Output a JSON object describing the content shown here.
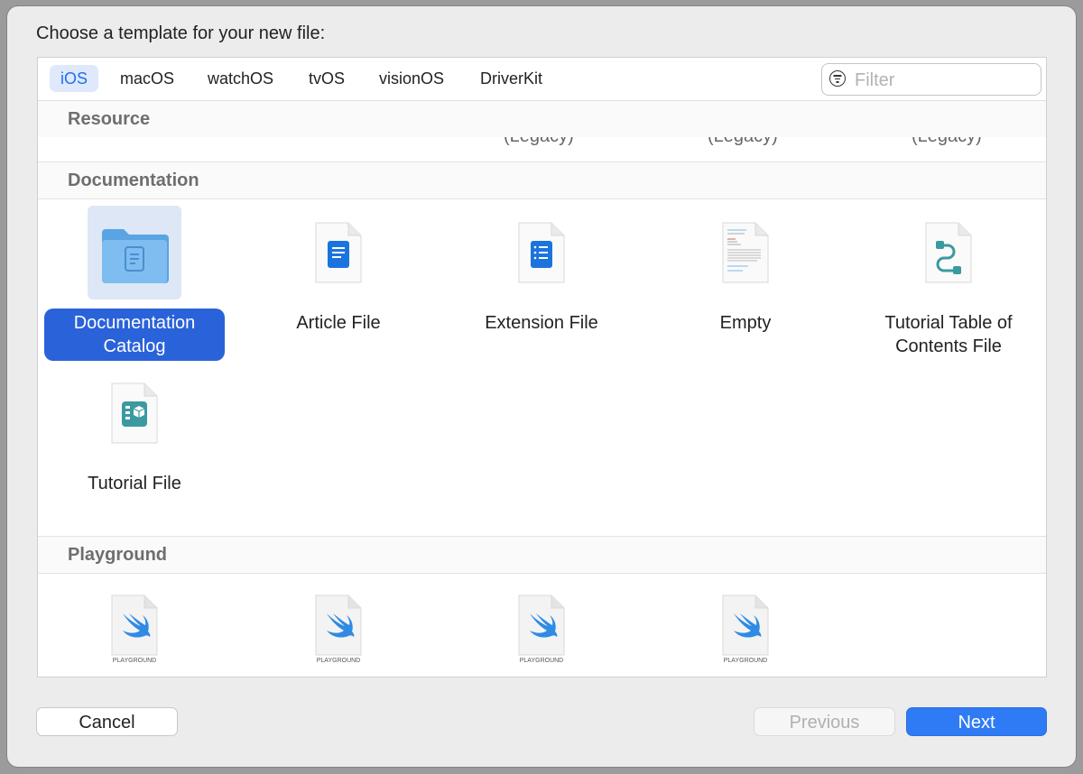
{
  "dialog": {
    "title": "Choose a template for your new file:"
  },
  "platform_tabs": [
    {
      "label": "iOS",
      "active": true
    },
    {
      "label": "macOS",
      "active": false
    },
    {
      "label": "watchOS",
      "active": false
    },
    {
      "label": "tvOS",
      "active": false
    },
    {
      "label": "visionOS",
      "active": false
    },
    {
      "label": "DriverKit",
      "active": false
    }
  ],
  "filter": {
    "placeholder": "Filter",
    "value": "",
    "icon": "filter-circle-icon"
  },
  "sections": {
    "resource": {
      "header": "Resource",
      "clipped_items": [
        "(Legacy)",
        "(Legacy)",
        "(Legacy)"
      ]
    },
    "documentation": {
      "header": "Documentation",
      "items": [
        {
          "label": "Documentation Catalog",
          "icon": "folder-doc-icon",
          "selected": true
        },
        {
          "label": "Article File",
          "icon": "article-file-icon",
          "selected": false
        },
        {
          "label": "Extension File",
          "icon": "extension-file-icon",
          "selected": false
        },
        {
          "label": "Empty",
          "icon": "empty-file-icon",
          "selected": false
        },
        {
          "label": "Tutorial Table of Contents File",
          "icon": "tutorial-toc-icon",
          "selected": false
        },
        {
          "label": "Tutorial File",
          "icon": "tutorial-file-icon",
          "selected": false
        }
      ]
    },
    "playground": {
      "header": "Playground",
      "items": [
        {
          "badge": "PLAYGROUND",
          "icon": "swift-playground-icon"
        },
        {
          "badge": "PLAYGROUND",
          "icon": "swift-playground-icon"
        },
        {
          "badge": "PLAYGROUND",
          "icon": "swift-playground-icon"
        },
        {
          "badge": "PLAYGROUND",
          "icon": "swift-playground-icon"
        }
      ]
    }
  },
  "buttons": {
    "cancel": "Cancel",
    "previous": "Previous",
    "previous_enabled": false,
    "next": "Next"
  },
  "colors": {
    "accent": "#2f7bf5",
    "selection": "#2a62d9",
    "tab_active_bg": "#dfe9fb",
    "section_header_text": "#6e6e6e"
  }
}
